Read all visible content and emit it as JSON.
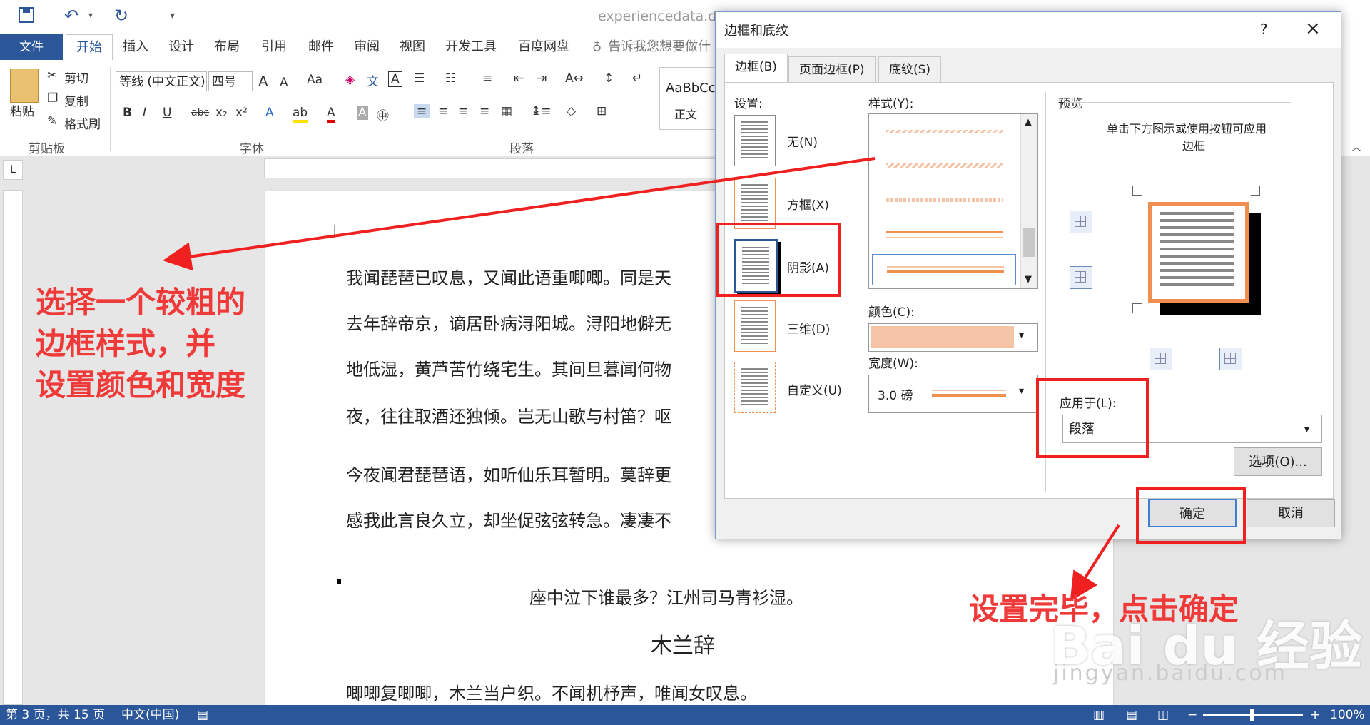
{
  "titlebar": {
    "doc_title": "experiencedata.doc"
  },
  "ribbon_tabs": [
    "文件",
    "开始",
    "插入",
    "设计",
    "布局",
    "引用",
    "邮件",
    "审阅",
    "视图",
    "开发工具",
    "百度网盘"
  ],
  "tell_me": "告诉我您想要做什么",
  "ribbon": {
    "paste": "粘贴",
    "cut": "剪切",
    "copy": "复制",
    "format_painter": "格式刷",
    "clipboard_group": "剪贴板",
    "font_group": "字体",
    "paragraph_group": "段落",
    "font_name": "等线 (中文正文)",
    "font_size": "四号",
    "style_preview": "AaBbCc",
    "style_name": "正文"
  },
  "document": {
    "paragraphs": [
      "我闻琵琶已叹息，又闻此语重唧唧。同是天",
      "去年辞帝京，谪居卧病浔阳城。浔阳地僻无",
      "地低湿，黄芦苦竹绕宅生。其间旦暮闻何物",
      "夜，往往取酒还独倾。岂无山歌与村笛？呕",
      "今夜闻君琵琶语，如听仙乐耳暂明。莫辞更",
      "感我此言良久立，却坐促弦弦转急。凄凄不"
    ],
    "center_line": "座中泣下谁最多？江州司马青衫湿。",
    "poem_title": "木兰辞",
    "last_line": "唧唧复唧唧，木兰当户织。不闻机杼声，唯闻女叹息。"
  },
  "statusbar": {
    "page_info": "第 3 页，共 15 页",
    "language": "中文(中国)",
    "zoom": "100%"
  },
  "dialog": {
    "title": "边框和底纹",
    "help": "?",
    "tabs": [
      "边框(B)",
      "页面边框(P)",
      "底纹(S)"
    ],
    "settings_label": "设置:",
    "settings": [
      "无(N)",
      "方框(X)",
      "阴影(A)",
      "三维(D)",
      "自定义(U)"
    ],
    "style_label": "样式(Y):",
    "color_label": "颜色(C):",
    "color_value": "#f5c3a5",
    "width_label": "宽度(W):",
    "width_value": "3.0 磅",
    "preview_label": "预览",
    "preview_hint_1": "单击下方图示或使用按钮可应用",
    "preview_hint_2": "边框",
    "apply_label": "应用于(L):",
    "apply_value": "段落",
    "options_button": "选项(O)...",
    "ok_button": "确定",
    "cancel_button": "取消",
    "border_color": "#f09050"
  },
  "annotations": {
    "left_line1": "选择一个较粗的",
    "left_line2": "边框样式，并",
    "left_line3": "设置颜色和宽度",
    "bottom": "设置完毕，点击确定",
    "accent": "#f02020"
  },
  "watermark": {
    "brand": "Bai du 经验",
    "url": "jingyan.baidu.com"
  }
}
